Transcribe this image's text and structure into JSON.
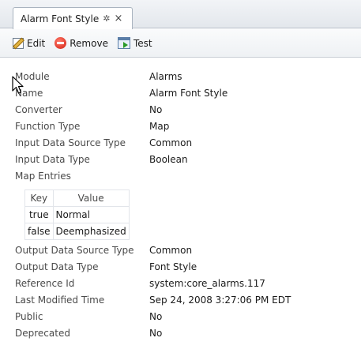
{
  "tab": {
    "title": "Alarm Font Style",
    "pin": "✲",
    "close": "×"
  },
  "toolbar": {
    "edit_label": "Edit",
    "remove_label": "Remove",
    "test_label": "Test"
  },
  "properties": {
    "module": {
      "label": "Module",
      "value": "Alarms"
    },
    "name": {
      "label": "Name",
      "value": "Alarm Font Style"
    },
    "converter": {
      "label": "Converter",
      "value": "No"
    },
    "function_type": {
      "label": "Function Type",
      "value": "Map"
    },
    "input_ds_type": {
      "label": "Input Data Source Type",
      "value": "Common"
    },
    "input_data_type": {
      "label": "Input Data Type",
      "value": "Boolean"
    },
    "map_entries_label": "Map Entries",
    "output_ds_type": {
      "label": "Output Data Source Type",
      "value": "Common"
    },
    "output_data_type": {
      "label": "Output Data Type",
      "value": "Font Style"
    },
    "reference_id": {
      "label": "Reference Id",
      "value": "system:core_alarms.117"
    },
    "last_modified": {
      "label": "Last Modified Time",
      "value": "Sep 24, 2008 3:27:06 PM EDT"
    },
    "public": {
      "label": "Public",
      "value": "No"
    },
    "deprecated": {
      "label": "Deprecated",
      "value": "No"
    }
  },
  "map_table": {
    "headers": [
      "Key",
      "Value"
    ],
    "rows": [
      {
        "key": "true",
        "value": "Normal"
      },
      {
        "key": "false",
        "value": "Deemphasized"
      }
    ]
  }
}
